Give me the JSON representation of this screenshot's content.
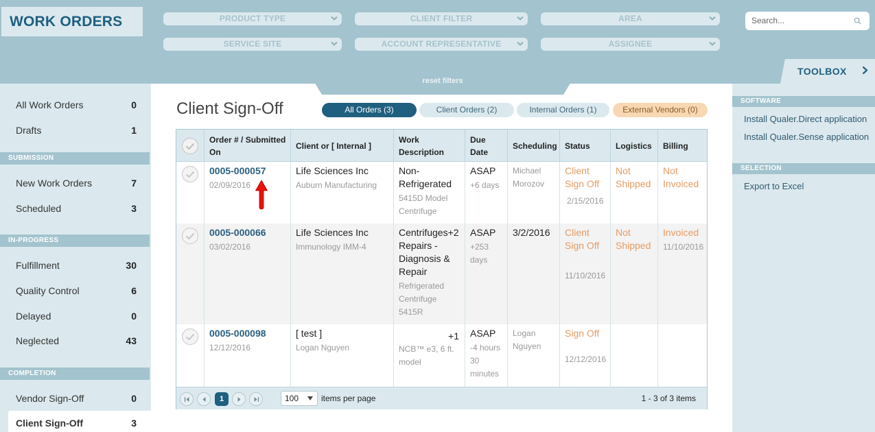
{
  "brand": "WORK ORDERS",
  "filters": {
    "product_type": "PRODUCT TYPE",
    "client_filter": "CLIENT FILTER",
    "area": "AREA",
    "service_site": "SERVICE SITE",
    "account_representative": "ACCOUNT REPRESENTATIVE",
    "assignee": "ASSIGNEE",
    "reset": "reset filters"
  },
  "search": {
    "placeholder": "Search..."
  },
  "toolbox": {
    "label": "TOOLBOX",
    "sections": [
      {
        "title": "SOFTWARE",
        "links": [
          "Install Qualer.Direct application",
          "Install Qualer.Sense application"
        ]
      },
      {
        "title": "SELECTION",
        "links": [
          "Export to Excel"
        ]
      }
    ]
  },
  "sidebar": {
    "top": [
      {
        "label": "All Work Orders",
        "count": "0"
      },
      {
        "label": "Drafts",
        "count": "1"
      }
    ],
    "sections": [
      {
        "title": "SUBMISSION",
        "items": [
          {
            "label": "New Work Orders",
            "count": "7"
          },
          {
            "label": "Scheduled",
            "count": "3"
          }
        ]
      },
      {
        "title": "IN-PROGRESS",
        "items": [
          {
            "label": "Fulfillment",
            "count": "30"
          },
          {
            "label": "Quality Control",
            "count": "6"
          },
          {
            "label": "Delayed",
            "count": "0"
          },
          {
            "label": "Neglected",
            "count": "43"
          }
        ]
      },
      {
        "title": "COMPLETION",
        "items": [
          {
            "label": "Vendor Sign-Off",
            "count": "0"
          },
          {
            "label": "Client Sign-Off",
            "count": "3"
          }
        ]
      }
    ]
  },
  "main": {
    "title": "Client Sign-Off",
    "tabs": {
      "all": "All Orders (3)",
      "client": "Client Orders (2)",
      "internal": "Internal Orders (1)",
      "external": "External Vendors (0)"
    },
    "columns": {
      "order_1": "Order # / Submitted",
      "order_2": "On",
      "client": "Client or [ Internal ]",
      "work_1": "Work",
      "work_2": "Description",
      "due_1": "Due",
      "due_2": "Date",
      "scheduling": "Scheduling",
      "status": "Status",
      "logistics": "Logistics",
      "billing": "Billing"
    },
    "rows": [
      {
        "order": "0005-000057",
        "submitted": "02/09/2016",
        "client": "Life Sciences Inc",
        "client_sub": "Auburn Manufacturing",
        "work_1": "Non-",
        "work_2": "Refrigerated",
        "work_sub_1": "5415D Model",
        "work_sub_2": "Centrifuge",
        "due": "ASAP",
        "due_sub": "+6 days",
        "sched_1": "Michael",
        "sched_2": "Morozov",
        "status_1": "Client",
        "status_2": "Sign Off",
        "status_date": "2/15/2016",
        "logistics_1": "Not",
        "logistics_2": "Shipped",
        "billing_1": "Not",
        "billing_2": "Invoiced"
      },
      {
        "order": "0005-000066",
        "submitted": "03/02/2016",
        "client": "Life Sciences Inc",
        "client_sub": "Immunology IMM-4",
        "work_1": "Centrifuges+2",
        "work_2": "Repairs -",
        "work_3": "Diagnosis &",
        "work_4": "Repair",
        "work_sub_1": "Refrigerated",
        "work_sub_2": "Centrifuge",
        "work_sub_3": "5415R",
        "due": "3/2/2016",
        "due_alt": "ASAP",
        "due_sub_1": "+253",
        "due_sub_2": "days",
        "status_1": "Client",
        "status_2": "Sign Off",
        "status_date": "11/10/2016",
        "logistics_1": "Not",
        "logistics_2": "Shipped",
        "billing_1": "Invoiced",
        "billing_date": "11/10/2016"
      },
      {
        "order": "0005-000098",
        "submitted": "12/12/2016",
        "client": "[ test ]",
        "client_sub": "Logan Nguyen",
        "work_plus": "+1",
        "work_sub_1": "NCB™ e3, 6 ft.",
        "work_sub_2": "model",
        "due": "ASAP",
        "due_sub_1": "-4 hours",
        "due_sub_2": "30",
        "due_sub_3": "minutes",
        "sched_1": "Logan",
        "sched_2": "Nguyen",
        "status_1": "Sign Off",
        "status_date": "12/12/2016"
      }
    ],
    "pager": {
      "current": "1",
      "per_page": "100",
      "per_page_label": "items per page",
      "range": "1 - 3 of 3 items"
    }
  },
  "colors": {
    "brand": "#1f5f80",
    "header": "#a3c3ce",
    "panel": "#dbe9ee",
    "accent_orange": "#e59b63",
    "external_tab": "#f8d8b2"
  }
}
